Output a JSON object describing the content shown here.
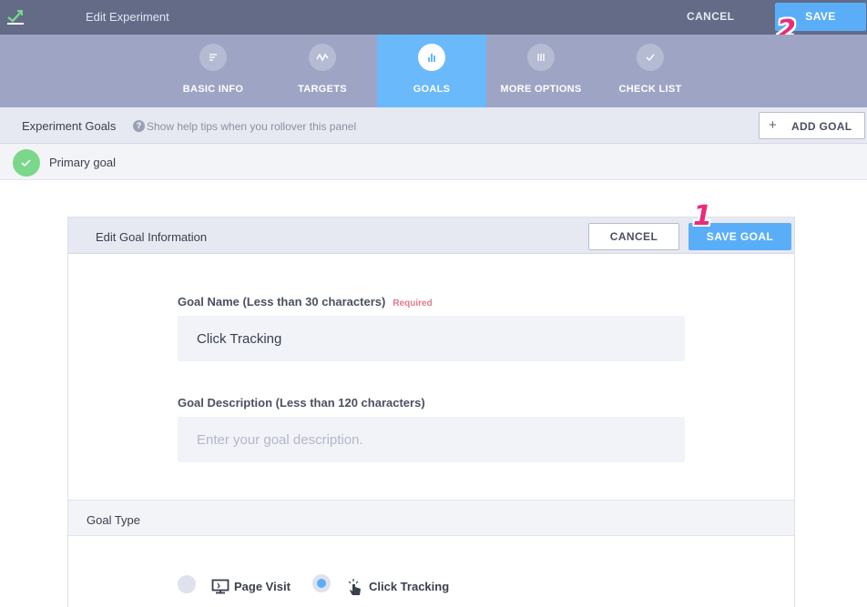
{
  "topbar": {
    "title": "Edit Experiment",
    "cancel_label": "CANCEL",
    "save_label": "SAVE",
    "step_badge": "2"
  },
  "tabs": [
    {
      "label": "BASIC INFO",
      "icon": "basic-info-icon",
      "active": false
    },
    {
      "label": "TARGETS",
      "icon": "targets-icon",
      "active": false
    },
    {
      "label": "GOALS",
      "icon": "goals-icon",
      "active": true
    },
    {
      "label": "MORE OPTIONS",
      "icon": "more-options-icon",
      "active": false
    },
    {
      "label": "CHECK LIST",
      "icon": "check-list-icon",
      "active": false
    }
  ],
  "goals_bar": {
    "title": "Experiment Goals",
    "help_text": "Show help tips when you rollover this panel",
    "add_goal_label": "ADD GOAL"
  },
  "primary_goal": {
    "label": "Primary goal"
  },
  "edit_panel": {
    "title": "Edit Goal Information",
    "cancel_label": "CANCEL",
    "save_label": "SAVE GOAL",
    "step_badge": "1",
    "goal_name": {
      "label": "Goal Name (Less than 30 characters)",
      "required_text": "Required",
      "value": "Click Tracking"
    },
    "goal_description": {
      "label": "Goal Description (Less than 120 characters)",
      "placeholder": "Enter your goal description.",
      "value": ""
    },
    "goal_type": {
      "title": "Goal Type",
      "options": [
        {
          "label": "Page Visit",
          "icon": "monitor-icon",
          "selected": false
        },
        {
          "label": "Click Tracking",
          "icon": "click-pointer-icon",
          "selected": true
        }
      ]
    }
  },
  "colors": {
    "topbar_bg": "#636b87",
    "tabnav_bg": "#9ea4c4",
    "accent": "#5aaef8",
    "active_tab": "#6ab9fb",
    "success": "#7bd88a",
    "step_badge": "#ea2b7b"
  }
}
